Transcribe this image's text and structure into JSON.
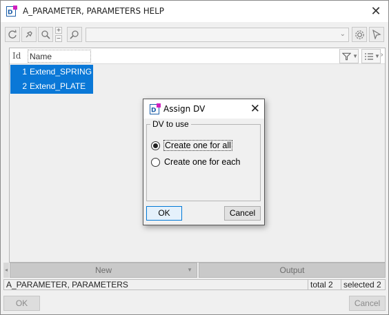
{
  "window": {
    "title": "A_PARAMETER, PARAMETERS HELP",
    "close_glyph": "✕"
  },
  "toolbar": {
    "icons": [
      "refresh-icon",
      "pin-icon",
      "zoom-icon",
      "zoom-plus",
      "zoom-minus",
      "search-icon",
      "settings-icon",
      "select-cursor-icon"
    ],
    "zoom_plus": "+",
    "zoom_minus": "−",
    "combo_value": "",
    "combo_arrow": "⌄"
  },
  "list": {
    "columns": {
      "id": "Id",
      "name": "Name"
    },
    "rows": [
      {
        "id": "1",
        "name": "Extend_SPRING"
      },
      {
        "id": "2",
        "name": "Extend_PLATE"
      }
    ],
    "selection_color": "#0a78d7"
  },
  "panel_buttons": {
    "new": "New",
    "output": "Output"
  },
  "status": {
    "source": "A_PARAMETER, PARAMETERS",
    "total": "total 2",
    "selected": "selected 2"
  },
  "footer": {
    "ok": "OK",
    "cancel": "Cancel"
  },
  "dialog": {
    "title": "Assign DV",
    "close_glyph": "✕",
    "group_label": "DV to use",
    "options": [
      {
        "label": "Create one for all",
        "checked": true
      },
      {
        "label": "Create one for each",
        "checked": false
      }
    ],
    "ok": "OK",
    "cancel": "Cancel"
  },
  "colors": {
    "accent": "#0a78d7",
    "app_icon_blue": "#1c5ea8",
    "app_icon_magenta": "#d11fbe"
  }
}
